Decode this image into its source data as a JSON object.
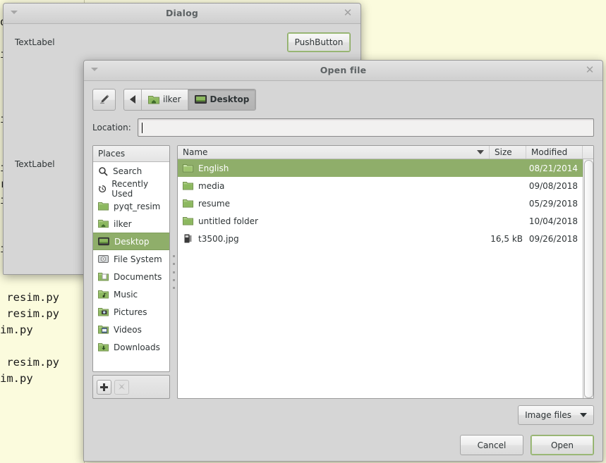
{
  "background": {
    "editor_text": "q\n\ni\n\n\n\ni\n\n\ni\nresim.py\nim.py\n\n resim.py\nim.py\n\n\n resim.py\n resim.py\nim.py\n\n resim.py\nim.py"
  },
  "dialog1": {
    "title": "Dialog",
    "menu_icon": "menu-triangle-icon",
    "close_icon": "close-icon",
    "label_top": "TextLabel",
    "label_mid": "TextLabel",
    "push_button": "PushButton"
  },
  "filedialog": {
    "title": "Open file",
    "menu_icon": "menu-triangle-icon",
    "close_icon": "close-icon",
    "toolbar": {
      "type_filename_icon": "pencil-icon",
      "back_icon": "back-arrow-icon",
      "crumbs": [
        {
          "label": "ilker",
          "icon": "home-folder-icon",
          "active": false
        },
        {
          "label": "Desktop",
          "icon": "desktop-icon",
          "active": true
        }
      ]
    },
    "location": {
      "label": "Location:",
      "value": "",
      "placeholder": ""
    },
    "places": {
      "header": "Places",
      "items": [
        {
          "label": "Search",
          "icon": "search-icon",
          "selected": false
        },
        {
          "label": "Recently Used",
          "icon": "history-icon",
          "selected": false
        },
        {
          "label": "pyqt_resim",
          "icon": "folder-icon",
          "selected": false
        },
        {
          "label": "ilker",
          "icon": "home-folder-icon",
          "selected": false
        },
        {
          "label": "Desktop",
          "icon": "desktop-icon",
          "selected": true
        },
        {
          "label": "File System",
          "icon": "harddisk-icon",
          "selected": false
        },
        {
          "label": "Documents",
          "icon": "documents-folder-icon",
          "selected": false
        },
        {
          "label": "Music",
          "icon": "music-folder-icon",
          "selected": false
        },
        {
          "label": "Pictures",
          "icon": "pictures-folder-icon",
          "selected": false
        },
        {
          "label": "Videos",
          "icon": "videos-folder-icon",
          "selected": false
        },
        {
          "label": "Downloads",
          "icon": "downloads-folder-icon",
          "selected": false
        }
      ],
      "add_icon": "plus-icon",
      "remove_icon": "cross-icon"
    },
    "filelist": {
      "columns": {
        "name": "Name",
        "size": "Size",
        "modified": "Modified"
      },
      "sort_icon": "sort-descending-icon",
      "rows": [
        {
          "name": "English",
          "size": "",
          "modified": "08/21/2014",
          "icon": "folder-icon",
          "selected": true
        },
        {
          "name": "media",
          "size": "",
          "modified": "09/08/2018",
          "icon": "folder-icon",
          "selected": false
        },
        {
          "name": "resume",
          "size": "",
          "modified": "05/29/2018",
          "icon": "folder-icon",
          "selected": false
        },
        {
          "name": "untitled folder",
          "size": "",
          "modified": "10/04/2018",
          "icon": "folder-icon",
          "selected": false
        },
        {
          "name": "t3500.jpg",
          "size": "16,5 kB",
          "modified": "09/26/2018",
          "icon": "image-file-icon",
          "selected": false
        }
      ]
    },
    "filter": {
      "value": "Image files",
      "caret_icon": "chevron-down-icon"
    },
    "buttons": {
      "cancel": "Cancel",
      "open": "Open"
    }
  },
  "colors": {
    "selection_green": "#8fae6a",
    "default_button_border": "#8aaa62",
    "window_bg": "#d6d6d6",
    "page_bg": "#fbfbdd",
    "title_text": "#5d6264"
  }
}
